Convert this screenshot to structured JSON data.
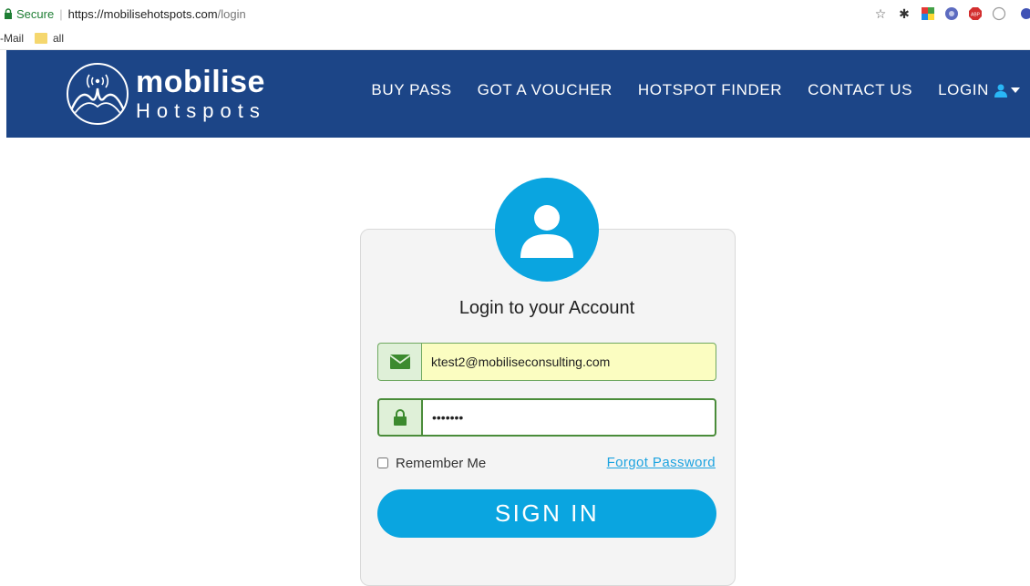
{
  "browser": {
    "secure_label": "Secure",
    "url_host": "https://mobilisehotspots.com",
    "url_path": "/login",
    "bookmarks": [
      {
        "label": "-Mail"
      },
      {
        "label": "all"
      }
    ]
  },
  "header": {
    "brand_name": "mobilise",
    "brand_sub": "Hotspots",
    "nav": {
      "buy_pass": "BUY PASS",
      "voucher": "GOT A VOUCHER",
      "finder": "HOTSPOT FINDER",
      "contact": "CONTACT US",
      "login": "LOGIN"
    },
    "color": "#1c4587"
  },
  "login": {
    "title": "Login to your Account",
    "email_value": "ktest2@mobiliseconsulting.com",
    "password_value": "•••••••",
    "remember_label": "Remember Me",
    "forgot_label": "Forgot Password",
    "signin_label": "SIGN IN",
    "accent_color": "#0aa5e0"
  },
  "icons": [
    "lock-icon",
    "star-icon",
    "user-icon",
    "envelope-icon",
    "padlock-icon",
    "caret-down-icon"
  ]
}
